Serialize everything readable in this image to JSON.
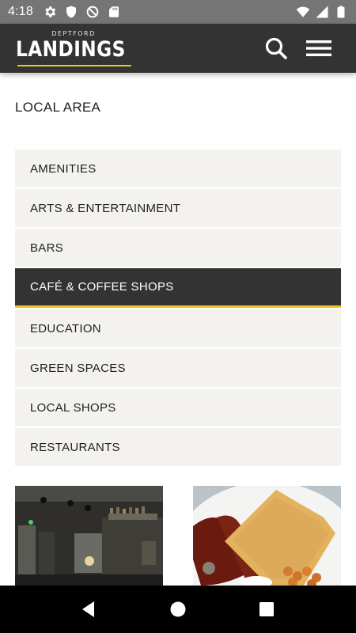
{
  "status_bar": {
    "time": "4:18",
    "left_icons": [
      "gear-icon",
      "shield-icon",
      "no-sync-icon",
      "sd-card-icon"
    ],
    "right_icons": [
      "wifi-icon",
      "cell-signal-icon",
      "battery-icon"
    ]
  },
  "header": {
    "logo_small": "DEPTFORD",
    "logo_big": "LANDINGS",
    "accent_color": "#f0c419",
    "background": "#333333",
    "icons": [
      "search-icon",
      "hamburger-menu-icon"
    ]
  },
  "page": {
    "title": "LOCAL AREA"
  },
  "categories": [
    {
      "label": "AMENITIES"
    },
    {
      "label": "ARTS & ENTERTAINMENT"
    },
    {
      "label": "BARS"
    },
    {
      "label": "CAFÉ & COFFEE SHOPS",
      "active": true
    },
    {
      "label": "EDUCATION"
    },
    {
      "label": "GREEN SPACES"
    },
    {
      "label": "LOCAL SHOPS"
    },
    {
      "label": "RESTAURANTS"
    }
  ],
  "thumbnails": [
    {
      "name": "cafe-interior-photo"
    },
    {
      "name": "breakfast-plate-photo"
    }
  ],
  "nav_bar": {
    "icons": [
      "back-icon",
      "home-icon",
      "recents-icon"
    ]
  }
}
